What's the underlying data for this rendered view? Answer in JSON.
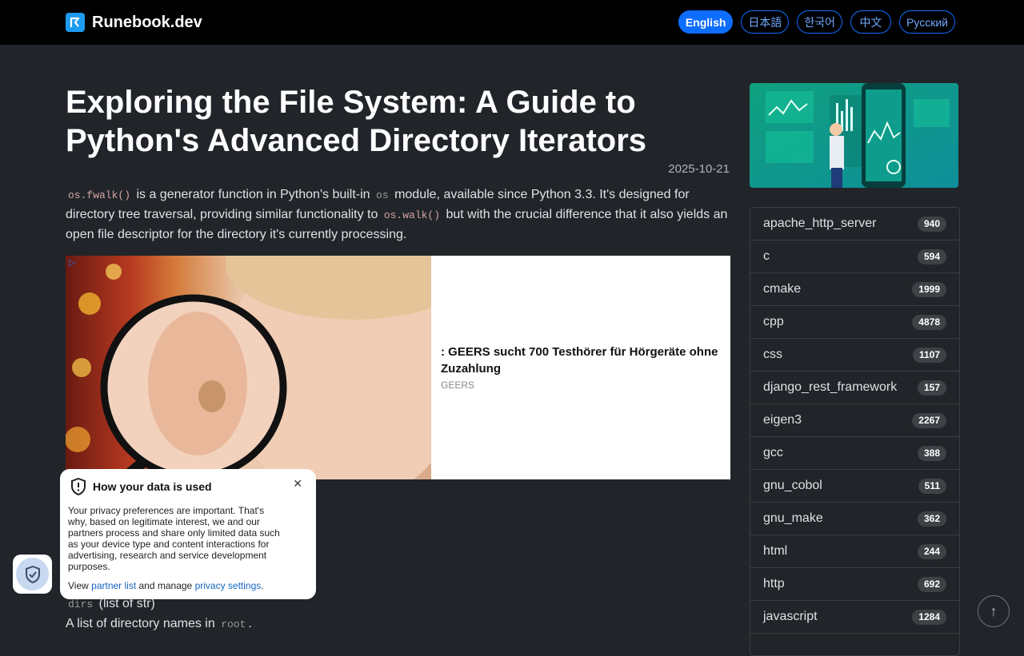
{
  "header": {
    "brand": "Runebook.dev",
    "languages": [
      {
        "label": "English",
        "active": true
      },
      {
        "label": "日本語",
        "active": false
      },
      {
        "label": "한국어",
        "active": false
      },
      {
        "label": "中文",
        "active": false
      },
      {
        "label": "Русский",
        "active": false
      }
    ]
  },
  "article": {
    "title": "Exploring the File System: A Guide to Python's Advanced Directory Iterators",
    "date": "2025-10-21",
    "intro": {
      "code1": "os.fwalk()",
      "text1": " is a generator function in Python's built-in ",
      "code2": "os",
      "text2": " module, available since Python 3.3. It's designed for directory tree traversal, providing similar functionality to ",
      "code3": "os.walk()",
      "text3": " but with the crucial difference that it also yields an open file descriptor for the directory it's currently processing."
    },
    "dirs_term": "dirs",
    "dirs_type": " (list of str)",
    "dirs_desc_pre": "A list of directory names in ",
    "dirs_desc_code": "root",
    "dirs_desc_post": "."
  },
  "ad": {
    "title": ": GEERS sucht 700 Testhörer für Hörgeräte ohne Zuzahlung",
    "source": "GEERS"
  },
  "sidebar": {
    "tags": [
      {
        "name": "apache_http_server",
        "count": "940"
      },
      {
        "name": "c",
        "count": "594"
      },
      {
        "name": "cmake",
        "count": "1999"
      },
      {
        "name": "cpp",
        "count": "4878"
      },
      {
        "name": "css",
        "count": "1107"
      },
      {
        "name": "django_rest_framework",
        "count": "157"
      },
      {
        "name": "eigen3",
        "count": "2267"
      },
      {
        "name": "gcc",
        "count": "388"
      },
      {
        "name": "gnu_cobol",
        "count": "511"
      },
      {
        "name": "gnu_make",
        "count": "362"
      },
      {
        "name": "html",
        "count": "244"
      },
      {
        "name": "http",
        "count": "692"
      },
      {
        "name": "javascript",
        "count": "1284"
      },
      {
        "name": "",
        "count": ""
      }
    ]
  },
  "privacy": {
    "title": "How your data is used",
    "body": "Your privacy preferences are important. That's why, based on legitimate interest, we and our partners process and share only limited data such as your device type and content interactions for advertising, research and service development purposes.",
    "footer_pre": "View ",
    "partner_link": "partner list",
    "footer_mid": " and manage ",
    "settings_link": "privacy settings",
    "footer_post": "."
  }
}
